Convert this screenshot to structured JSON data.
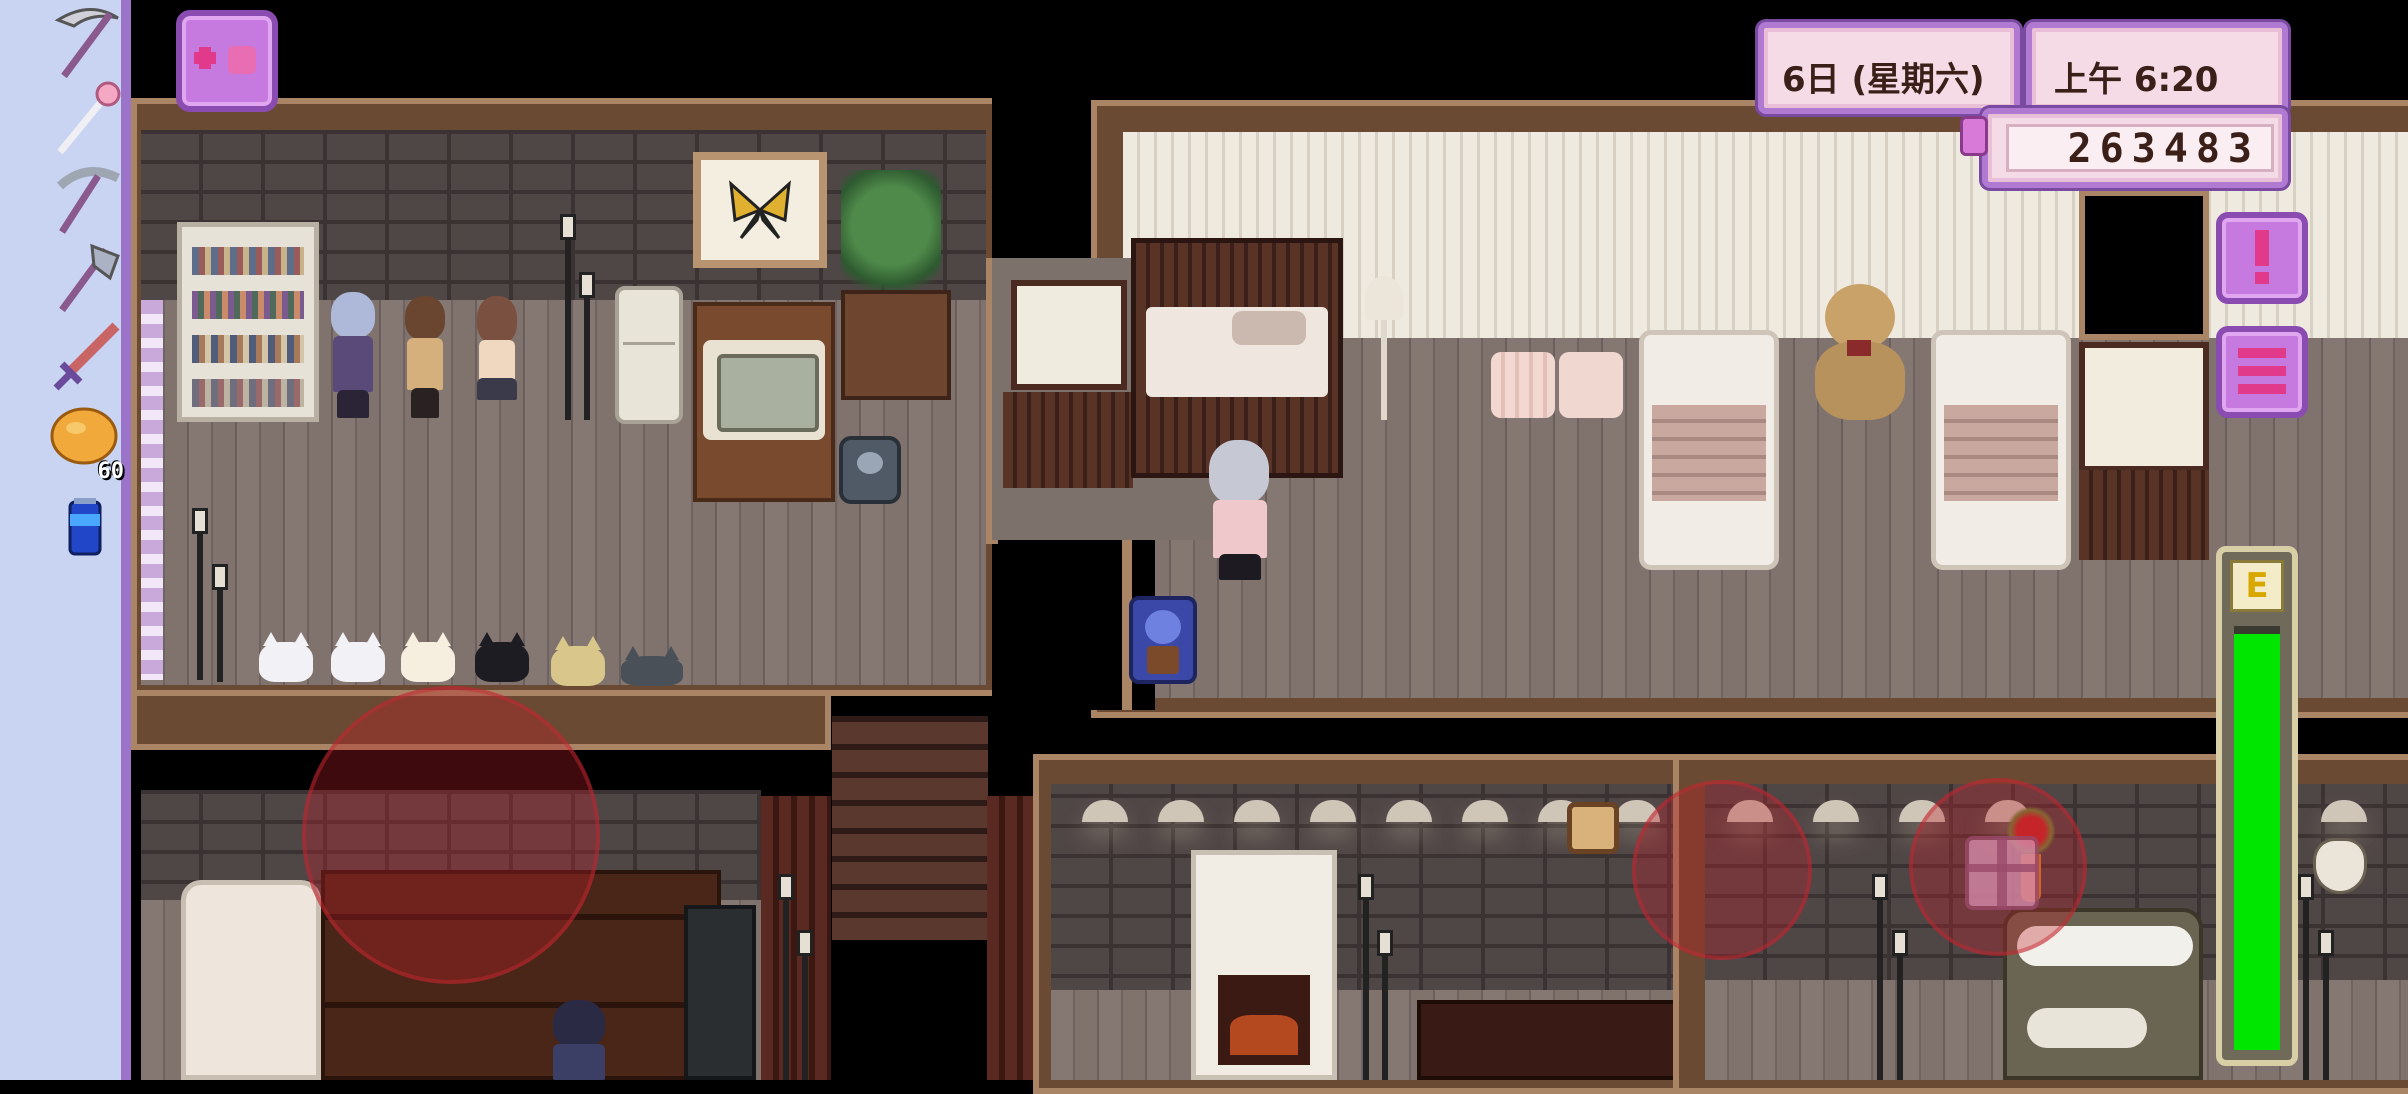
{
  "hud": {
    "date": "6日 (星期六)",
    "time": "上午 6:20",
    "money": "263483",
    "energy_label": "E",
    "energy_fraction": 0.98
  },
  "toolbar": {
    "items": [
      {
        "name": "scythe-icon"
      },
      {
        "name": "magic-wand-icon"
      },
      {
        "name": "pickaxe-icon"
      },
      {
        "name": "axe-icon"
      },
      {
        "name": "sword-icon"
      },
      {
        "name": "bread-icon",
        "count": "60"
      },
      {
        "name": "blue-can-icon"
      }
    ]
  },
  "colors": {
    "toolbar_bg": "#c9d4f3",
    "toolbar_border": "#9b74c9",
    "hud_frame": "#b07ad2",
    "hud_fill": "#f4dbe5",
    "energy_green": "#00e600",
    "control_circle": "#be1e28"
  }
}
